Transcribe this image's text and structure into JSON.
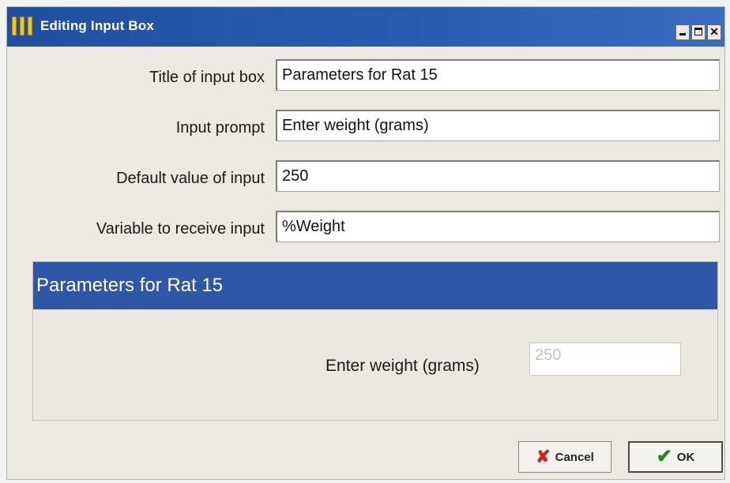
{
  "window": {
    "title": "Editing Input Box",
    "app_icon": "yellow-bars-icon",
    "controls": [
      "minimize-icon",
      "maximize-icon",
      "close-icon"
    ]
  },
  "fields": {
    "title": {
      "label": "Title of input box",
      "value": "Parameters for Rat 15"
    },
    "prompt": {
      "label": "Input prompt",
      "value": "Enter weight (grams)"
    },
    "default": {
      "label": "Default value of input",
      "value": "250"
    },
    "variable": {
      "label": "Variable to receive input",
      "value": "%Weight"
    }
  },
  "preview": {
    "title": "Parameters for Rat 15",
    "prompt": "Enter weight (grams)",
    "value": "250"
  },
  "buttons": {
    "cancel": "Cancel",
    "ok": "OK"
  },
  "colors": {
    "titlebar": "#2a5cb4",
    "preview_header": "#2e57a6",
    "cancel_icon": "#c8261e",
    "ok_icon": "#1c8a1c"
  }
}
